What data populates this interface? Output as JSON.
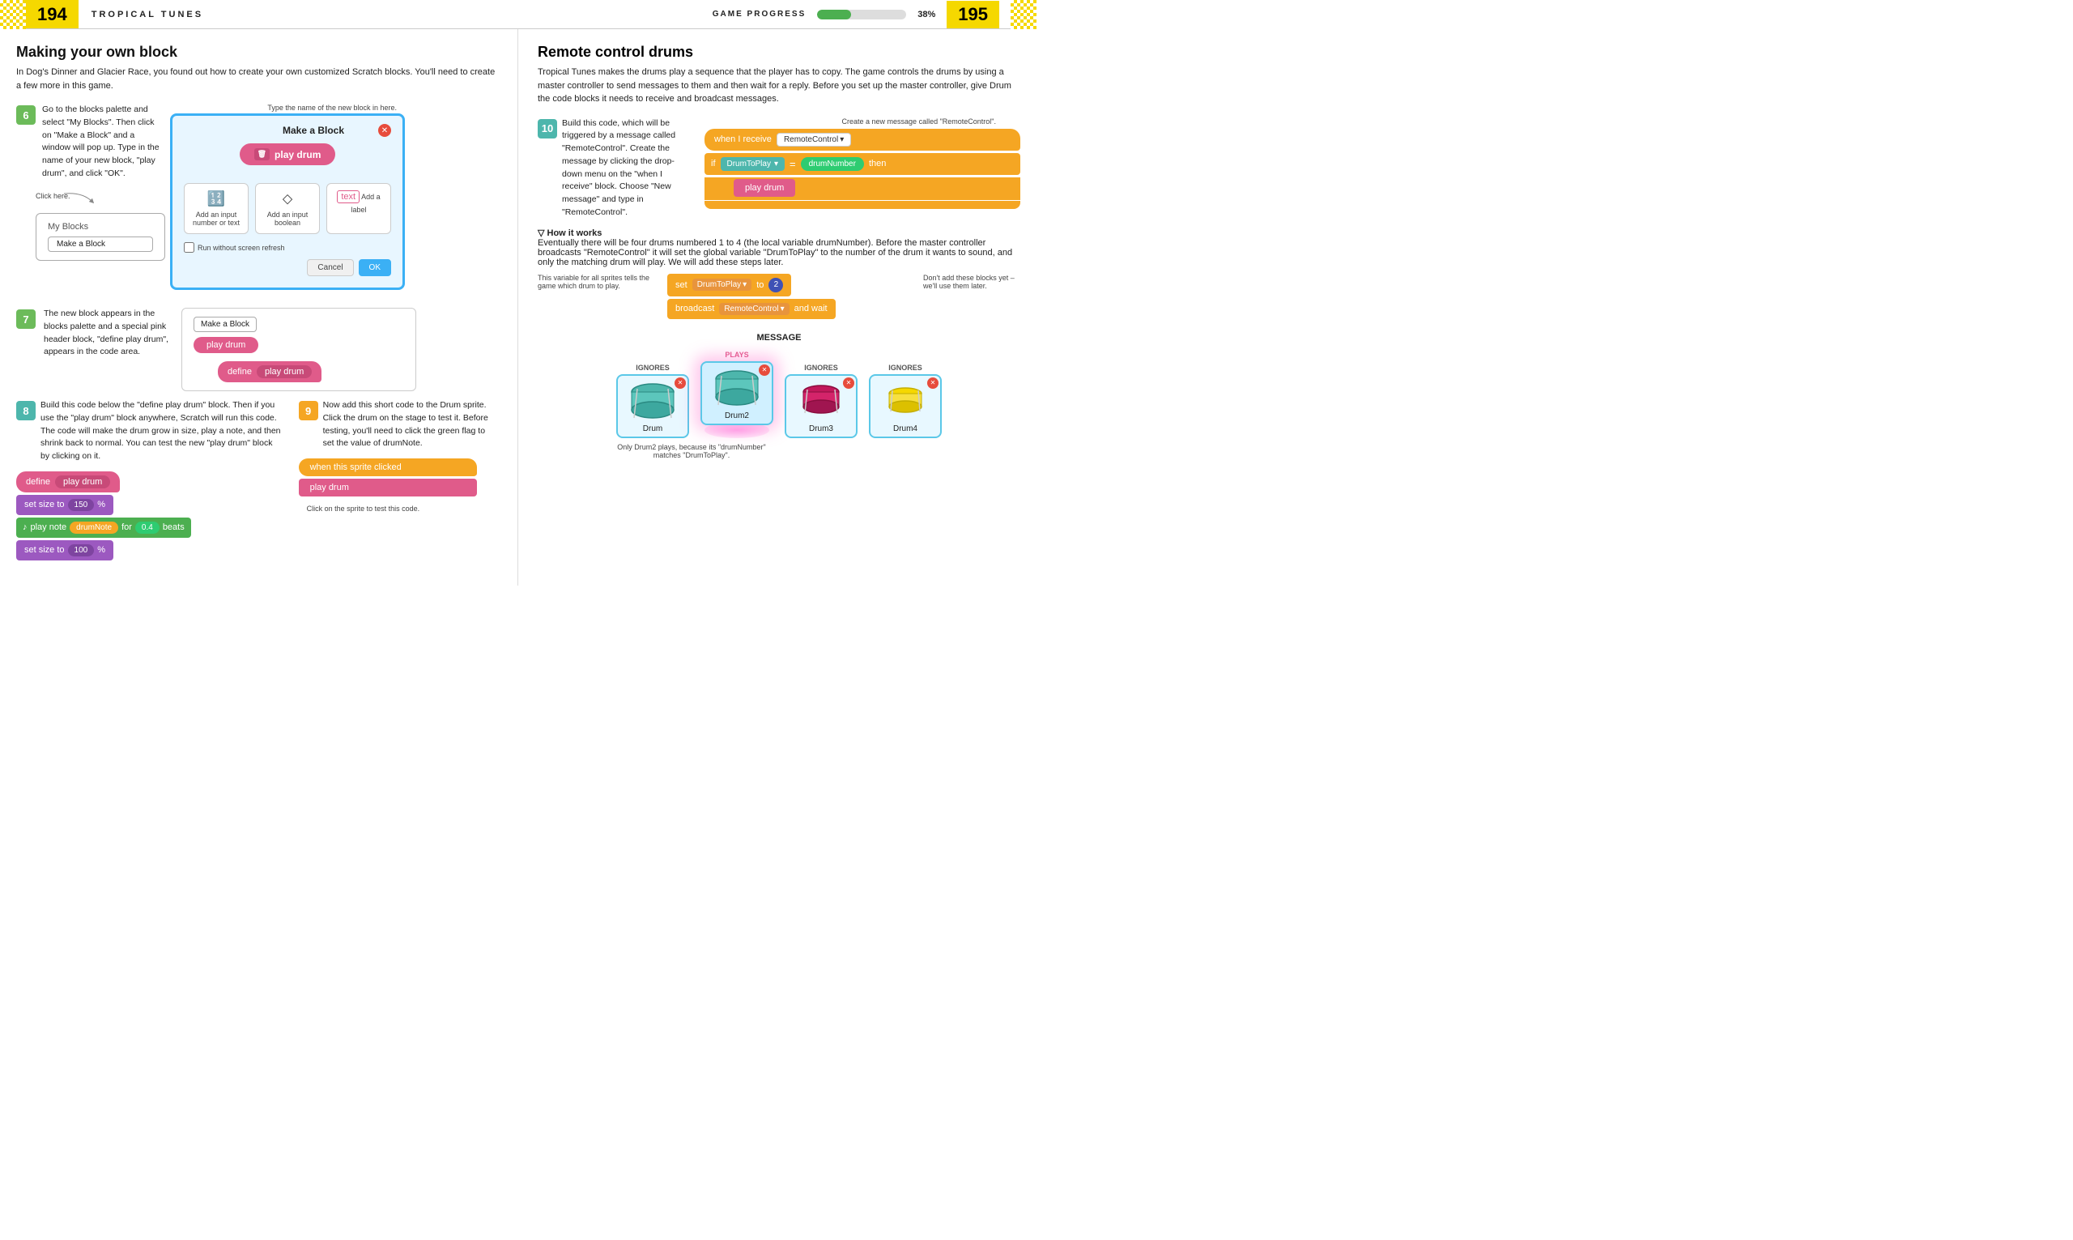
{
  "header": {
    "page_left": "194",
    "page_right": "195",
    "title_left": "TROPICAL TUNES",
    "progress_label": "GAME PROGRESS",
    "progress_percent": "38%",
    "progress_value": 38
  },
  "left": {
    "section_title": "Making your own block",
    "section_intro": "In Dog's Dinner and Glacier Race, you found out how to create your own customized Scratch blocks. You'll need to create a few more in this game.",
    "callout_dialog": "Type the name of the new block in here.",
    "callout_click": "Click here.",
    "steps": [
      {
        "num": "6",
        "color": "green",
        "text": "Go to the blocks palette and select \"My Blocks\". Then click on \"Make a Block\" and a window will pop up. Type in the name of your new block, \"play drum\", and click \"OK\"."
      },
      {
        "num": "7",
        "color": "green",
        "text": "The new block appears in the blocks palette and a special pink header block, \"define play drum\", appears in the code area."
      },
      {
        "num": "8",
        "color": "teal",
        "text": "Build this code below the \"define play drum\" block. Then if you use the \"play drum\" block anywhere, Scratch will run this code. The code will make the drum grow in size, play a note, and then shrink back to normal. You can test the new \"play drum\" block by clicking on it."
      },
      {
        "num": "9",
        "color": "orange",
        "text": "Now add this short code to the Drum sprite. Click the drum on the stage to test it. Before testing, you'll need to click the green flag to set the value of drumNote."
      }
    ],
    "dialog": {
      "title": "Make a Block",
      "block_name": "play drum",
      "option1_label": "Add an input\nnumber or text",
      "option2_label": "Add an input\nboolean",
      "option3_label": "Add a label",
      "checkbox_label": "Run without screen refresh",
      "cancel": "Cancel",
      "ok": "OK"
    },
    "my_blocks": {
      "label": "My Blocks",
      "make_button": "Make a Block"
    },
    "code_step8": {
      "define": "define",
      "play_drum": "play drum",
      "set_size_1": "set size to",
      "val_150": "150",
      "percent": "%",
      "play_note": "play note",
      "drum_note": "drumNote",
      "for": "for",
      "beats_val": "0.4",
      "beats": "beats",
      "set_size_2": "set size to",
      "val_100": "100"
    },
    "code_step9": {
      "when_clicked": "when this sprite clicked",
      "play_drum": "play drum"
    },
    "step9_callout": "Click on the sprite to test this code."
  },
  "right": {
    "section_title": "Remote control drums",
    "section_intro": "Tropical Tunes makes the drums play a sequence that the player has to copy. The game controls the drums by using a master controller to send messages to them and then wait for a reply. Before you set up the master controller, give Drum the code blocks it needs to receive and broadcast messages.",
    "callout_new_msg": "Create a new message called \"RemoteControl\".",
    "callout_variable": "This variable for all sprites tells the game which drum to play.",
    "callout_dont_add": "Don't add these blocks yet – we'll use them later.",
    "steps": [
      {
        "num": "10",
        "color": "teal",
        "text": "Build this code, which will be triggered by a message called \"RemoteControl\". Create the message by clicking the drop-down menu on the \"when I receive\" block. Choose \"New message\" and type in \"RemoteControl\"."
      }
    ],
    "code_rc": {
      "when_receive": "when I receive",
      "remote_control": "RemoteControl",
      "if_label": "if",
      "drum_to_play": "DrumToPlay",
      "equals": "=",
      "drum_number": "drumNumber",
      "then": "then",
      "play_drum": "play drum"
    },
    "how_it_works": {
      "title": "▽ How it works",
      "text": "Eventually there will be four drums numbered 1 to 4 (the local variable drumNumber). Before the master controller broadcasts \"RemoteControl\" it will set the global variable \"DrumToPlay\" to the number of the drum it wants to sound, and only the matching drum will play. We will add these steps later."
    },
    "code_set": {
      "set": "set",
      "drum_to_play": "DrumToPlay",
      "to": "to",
      "val": "2",
      "broadcast": "broadcast",
      "remote_control": "RemoteControl",
      "and_wait": "and wait"
    },
    "message_label": "MESSAGE",
    "drums": [
      {
        "label": "Drum",
        "tag": "IGNORES",
        "playing": false,
        "color": "#4db6ac"
      },
      {
        "label": "Drum2",
        "tag": "PLAYS",
        "playing": true,
        "color": "#4db6ac"
      },
      {
        "label": "Drum3",
        "tag": "IGNORES",
        "playing": false,
        "color": "#c2185b"
      },
      {
        "label": "Drum4",
        "tag": "IGNORES",
        "playing": false,
        "color": "#f5d800"
      }
    ],
    "callout_drum2": "Only Drum2 plays, because its \"drumNumber\" matches \"DrumToPlay\"."
  }
}
